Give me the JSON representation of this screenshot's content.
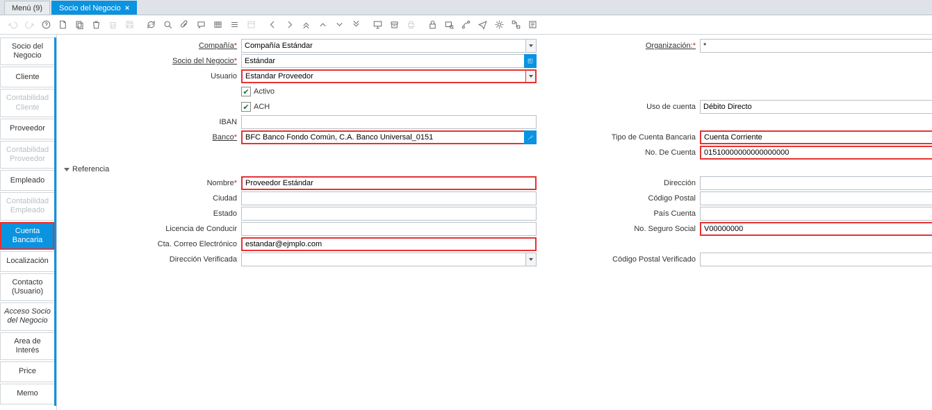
{
  "tabs": {
    "menu": "Menú (9)",
    "active": "Socio del Negocio"
  },
  "toolbar_names": [
    "undo",
    "redo",
    "help",
    "new",
    "copy",
    "delete",
    "delete-selected",
    "save",
    "refresh",
    "requery",
    "search",
    "attachment",
    "chat",
    "grid",
    "toggle-multi",
    "zoom-across",
    "prev-record",
    "next-record",
    "first-record",
    "parent-record",
    "detail-record",
    "last-record",
    "report",
    "archive",
    "print",
    "lock",
    "find",
    "workflow",
    "send",
    "setup",
    "active-wf",
    "posdoc"
  ],
  "sidebar": {
    "items": [
      {
        "label": "Socio del Negocio",
        "state": ""
      },
      {
        "label": "Cliente",
        "state": ""
      },
      {
        "label": "Contabilidad Cliente",
        "state": "disabled"
      },
      {
        "label": "Proveedor",
        "state": ""
      },
      {
        "label": "Contabilidad Proveedor",
        "state": "disabled"
      },
      {
        "label": "Empleado",
        "state": ""
      },
      {
        "label": "Contabilidad Empleado",
        "state": "disabled"
      },
      {
        "label": "Cuenta Bancaria",
        "state": "active"
      },
      {
        "label": "Localización",
        "state": ""
      },
      {
        "label": "Contacto (Usuario)",
        "state": ""
      },
      {
        "label": "Acceso Socio del Negocio",
        "state": "italic"
      },
      {
        "label": "Area de Interés",
        "state": ""
      },
      {
        "label": "Price",
        "state": ""
      },
      {
        "label": "Memo",
        "state": ""
      }
    ]
  },
  "labels": {
    "compania": "Compañía",
    "organizacion": "Organización:",
    "socio": "Socio del Negocio",
    "usuario": "Usuario",
    "activo": "Activo",
    "ach": "ACH",
    "uso": "Uso de cuenta",
    "iban": "IBAN",
    "banco": "Banco",
    "tipocuenta": "Tipo de Cuenta Bancaria",
    "nocuenta": "No. De Cuenta",
    "referencia": "Referencia",
    "nombre": "Nombre",
    "direccion": "Dirección",
    "ciudad": "Ciudad",
    "codpostal": "Código Postal",
    "estado": "Estado",
    "paiscuenta": "País Cuenta",
    "licencia": "Licencia de Conducir",
    "seguro": "No. Seguro Social",
    "correo": "Cta. Correo Electrónico",
    "dirverificada": "Dirección Verificada",
    "cpverificado": "Código Postal Verificado"
  },
  "values": {
    "compania": "Compañía Estándar",
    "organizacion": "*",
    "socio": "Estándar",
    "usuario": "Estandar Proveedor",
    "activo": true,
    "ach": true,
    "uso": "Débito Directo",
    "iban": "",
    "banco": "BFC Banco Fondo Común, C.A. Banco Universal_0151",
    "tipocuenta": "Cuenta Corriente",
    "nocuenta": "01510000000000000000",
    "nombre": "Proveedor Estándar",
    "direccion": "",
    "ciudad": "",
    "codpostal": "",
    "estado": "",
    "paiscuenta": "",
    "licencia": "",
    "seguro": "V00000000",
    "correo": "estandar@ejmplo.com",
    "dirverificada": "",
    "cpverificado": ""
  }
}
